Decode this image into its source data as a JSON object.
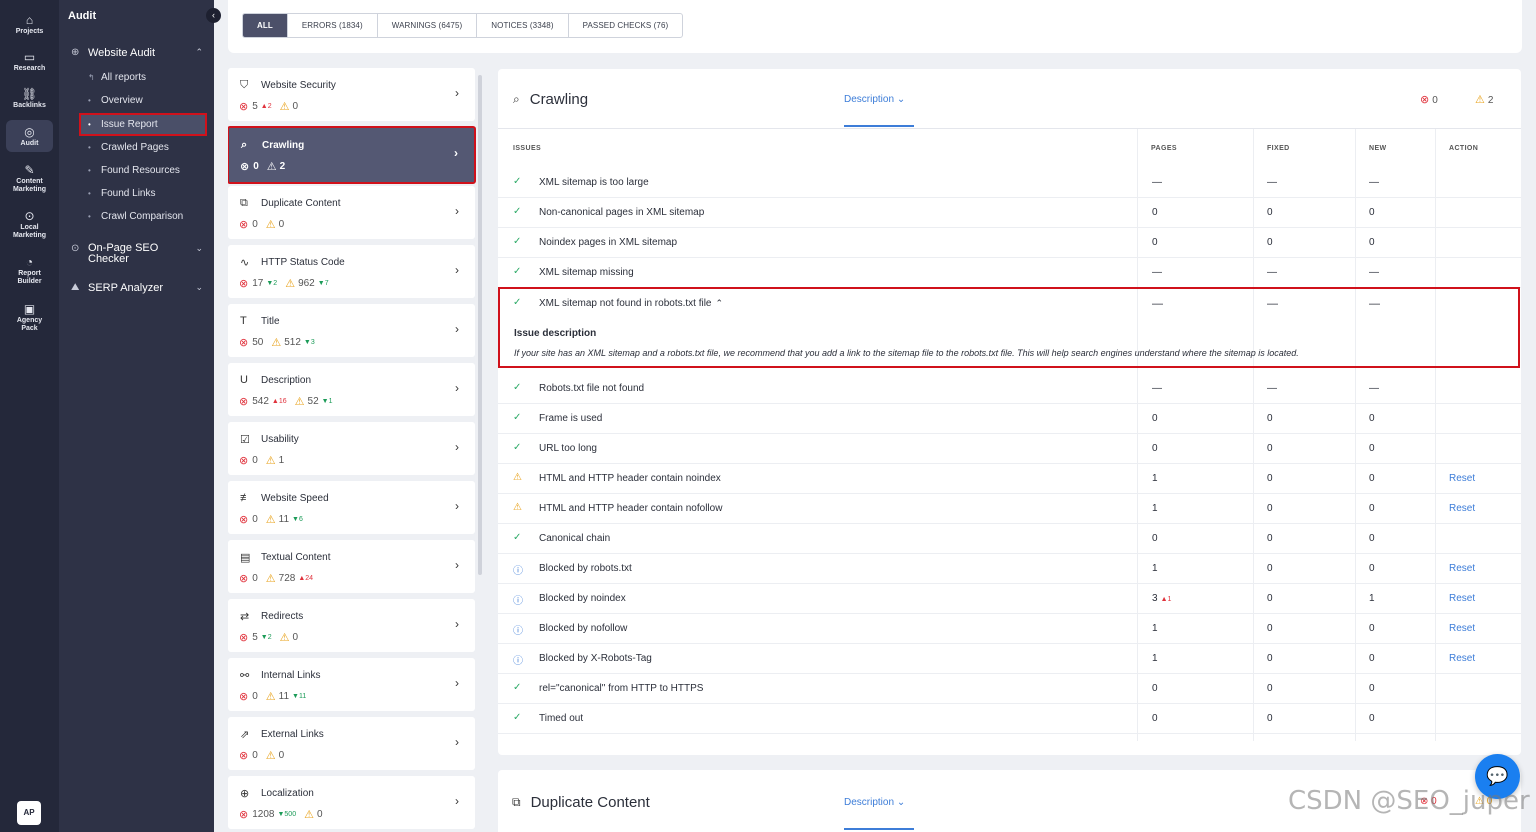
{
  "rail": {
    "items": [
      {
        "label": "Projects",
        "icon": "⌂"
      },
      {
        "label": "Research",
        "icon": "▭"
      },
      {
        "label": "Backlinks",
        "icon": "⛓"
      },
      {
        "label": "Audit",
        "icon": "◎"
      },
      {
        "label": "Content Marketing",
        "icon": "✎"
      },
      {
        "label": "Local Marketing",
        "icon": "⊙"
      },
      {
        "label": "Report Builder",
        "icon": "◔"
      },
      {
        "label": "Agency Pack",
        "icon": "▣"
      }
    ],
    "avatar": "AP"
  },
  "nav": {
    "title": "Audit",
    "collapse_icon": "‹",
    "website_audit": "Website Audit",
    "subitems": [
      "All reports",
      "Overview",
      "Issue Report",
      "Crawled Pages",
      "Found Resources",
      "Found Links",
      "Crawl Comparison"
    ],
    "onpage": "On-Page SEO Checker",
    "serp": "SERP Analyzer"
  },
  "tabs": [
    "ALL",
    "ERRORS (1834)",
    "WARNINGS (6475)",
    "NOTICES (3348)",
    "PASSED CHECKS (76)"
  ],
  "categories": [
    {
      "name": "Website Security",
      "icon": "⛉",
      "errors": "5",
      "err_delta": "2",
      "err_dir": "▲",
      "warnings": "0",
      "warn_delta": "",
      "warn_dir": ""
    },
    {
      "name": "Crawling",
      "icon": "⌕",
      "errors": "0",
      "err_delta": "",
      "err_dir": "",
      "warnings": "2",
      "warn_delta": "",
      "warn_dir": ""
    },
    {
      "name": "Duplicate Content",
      "icon": "⧉",
      "errors": "0",
      "err_delta": "",
      "err_dir": "",
      "warnings": "0",
      "warn_delta": "",
      "warn_dir": ""
    },
    {
      "name": "HTTP Status Code",
      "icon": "∿",
      "errors": "17",
      "err_delta": "2",
      "err_dir": "▼",
      "warnings": "962",
      "warn_delta": "7",
      "warn_dir": "▼"
    },
    {
      "name": "Title",
      "icon": "T",
      "errors": "50",
      "err_delta": "",
      "err_dir": "",
      "warnings": "512",
      "warn_delta": "3",
      "warn_dir": "▼"
    },
    {
      "name": "Description",
      "icon": "U",
      "errors": "542",
      "err_delta": "16",
      "err_dir": "▲",
      "warnings": "52",
      "warn_delta": "1",
      "warn_dir": "▼"
    },
    {
      "name": "Usability",
      "icon": "☑",
      "errors": "0",
      "err_delta": "",
      "err_dir": "",
      "warnings": "1",
      "warn_delta": "",
      "warn_dir": ""
    },
    {
      "name": "Website Speed",
      "icon": "≢",
      "errors": "0",
      "err_delta": "",
      "err_dir": "",
      "warnings": "11",
      "warn_delta": "6",
      "warn_dir": "▼"
    },
    {
      "name": "Textual Content",
      "icon": "▤",
      "errors": "0",
      "err_delta": "",
      "err_dir": "",
      "warnings": "728",
      "warn_delta": "24",
      "warn_dir": "▲"
    },
    {
      "name": "Redirects",
      "icon": "⇄",
      "errors": "5",
      "err_delta": "2",
      "err_dir": "▼",
      "warnings": "0",
      "warn_delta": "",
      "warn_dir": ""
    },
    {
      "name": "Internal Links",
      "icon": "⚯",
      "errors": "0",
      "err_delta": "",
      "err_dir": "",
      "warnings": "11",
      "warn_delta": "11",
      "warn_dir": "▼"
    },
    {
      "name": "External Links",
      "icon": "⇗",
      "errors": "0",
      "err_delta": "",
      "err_dir": "",
      "warnings": "0",
      "warn_delta": "",
      "warn_dir": ""
    },
    {
      "name": "Localization",
      "icon": "⊕",
      "errors": "1208",
      "err_delta": "500",
      "err_dir": "▼",
      "warnings": "0",
      "warn_delta": "",
      "warn_dir": ""
    }
  ],
  "main": {
    "title": "Crawling",
    "description_link": "Description",
    "errors": "0",
    "warnings": "2",
    "columns": {
      "issues": "ISSUES",
      "pages": "PAGES",
      "fixed": "FIXED",
      "new": "NEW",
      "action": "ACTION"
    },
    "rows_top": [
      {
        "status": "ok",
        "name": "XML sitemap is too large",
        "pages": "—",
        "fixed": "—",
        "new": "—",
        "action": ""
      },
      {
        "status": "ok",
        "name": "Non-canonical pages in XML sitemap",
        "pages": "0",
        "fixed": "0",
        "new": "0",
        "action": ""
      },
      {
        "status": "ok",
        "name": "Noindex pages in XML sitemap",
        "pages": "0",
        "fixed": "0",
        "new": "0",
        "action": ""
      },
      {
        "status": "ok",
        "name": "XML sitemap missing",
        "pages": "—",
        "fixed": "—",
        "new": "—",
        "action": ""
      }
    ],
    "expanded": {
      "name": "XML sitemap not found in robots.txt file",
      "pages": "—",
      "fixed": "—",
      "new": "—",
      "heading": "Issue description",
      "text": "If your site has an XML sitemap and a robots.txt file, we recommend that you add a link to the sitemap file to the robots.txt file. This will help search engines understand where the sitemap is located."
    },
    "rows_bottom": [
      {
        "status": "ok",
        "name": "Robots.txt file not found",
        "pages": "—",
        "fixed": "—",
        "new": "—",
        "action": "",
        "delta": ""
      },
      {
        "status": "ok",
        "name": "Frame is used",
        "pages": "0",
        "fixed": "0",
        "new": "0",
        "action": "",
        "delta": ""
      },
      {
        "status": "ok",
        "name": "URL too long",
        "pages": "0",
        "fixed": "0",
        "new": "0",
        "action": "",
        "delta": ""
      },
      {
        "status": "warn",
        "name": "HTML and HTTP header contain noindex",
        "pages": "1",
        "fixed": "0",
        "new": "0",
        "action": "Reset",
        "delta": ""
      },
      {
        "status": "warn",
        "name": "HTML and HTTP header contain nofollow",
        "pages": "1",
        "fixed": "0",
        "new": "0",
        "action": "Reset",
        "delta": ""
      },
      {
        "status": "ok",
        "name": "Canonical chain",
        "pages": "0",
        "fixed": "0",
        "new": "0",
        "action": "",
        "delta": ""
      },
      {
        "status": "info",
        "name": "Blocked by robots.txt",
        "pages": "1",
        "fixed": "0",
        "new": "0",
        "action": "Reset",
        "delta": ""
      },
      {
        "status": "info",
        "name": "Blocked by noindex",
        "pages": "3",
        "fixed": "0",
        "new": "1",
        "action": "Reset",
        "delta": "1"
      },
      {
        "status": "info",
        "name": "Blocked by nofollow",
        "pages": "1",
        "fixed": "0",
        "new": "0",
        "action": "Reset",
        "delta": ""
      },
      {
        "status": "info",
        "name": "Blocked by X-Robots-Tag",
        "pages": "1",
        "fixed": "0",
        "new": "0",
        "action": "Reset",
        "delta": ""
      },
      {
        "status": "ok",
        "name": "rel=\"canonical\" from HTTP to HTTPS",
        "pages": "0",
        "fixed": "0",
        "new": "0",
        "action": "",
        "delta": ""
      },
      {
        "status": "ok",
        "name": "Timed out",
        "pages": "0",
        "fixed": "0",
        "new": "0",
        "action": "",
        "delta": ""
      }
    ]
  },
  "card2": {
    "title": "Duplicate Content",
    "description_link": "Description",
    "errors": "0",
    "warnings": "0"
  },
  "watermark": "CSDN @SEO_juper",
  "colors": {
    "accent": "#3d7dd8",
    "error": "#e0323c",
    "warning": "#e8a21a",
    "ok": "#2daa67",
    "highlight": "#d0111b"
  }
}
